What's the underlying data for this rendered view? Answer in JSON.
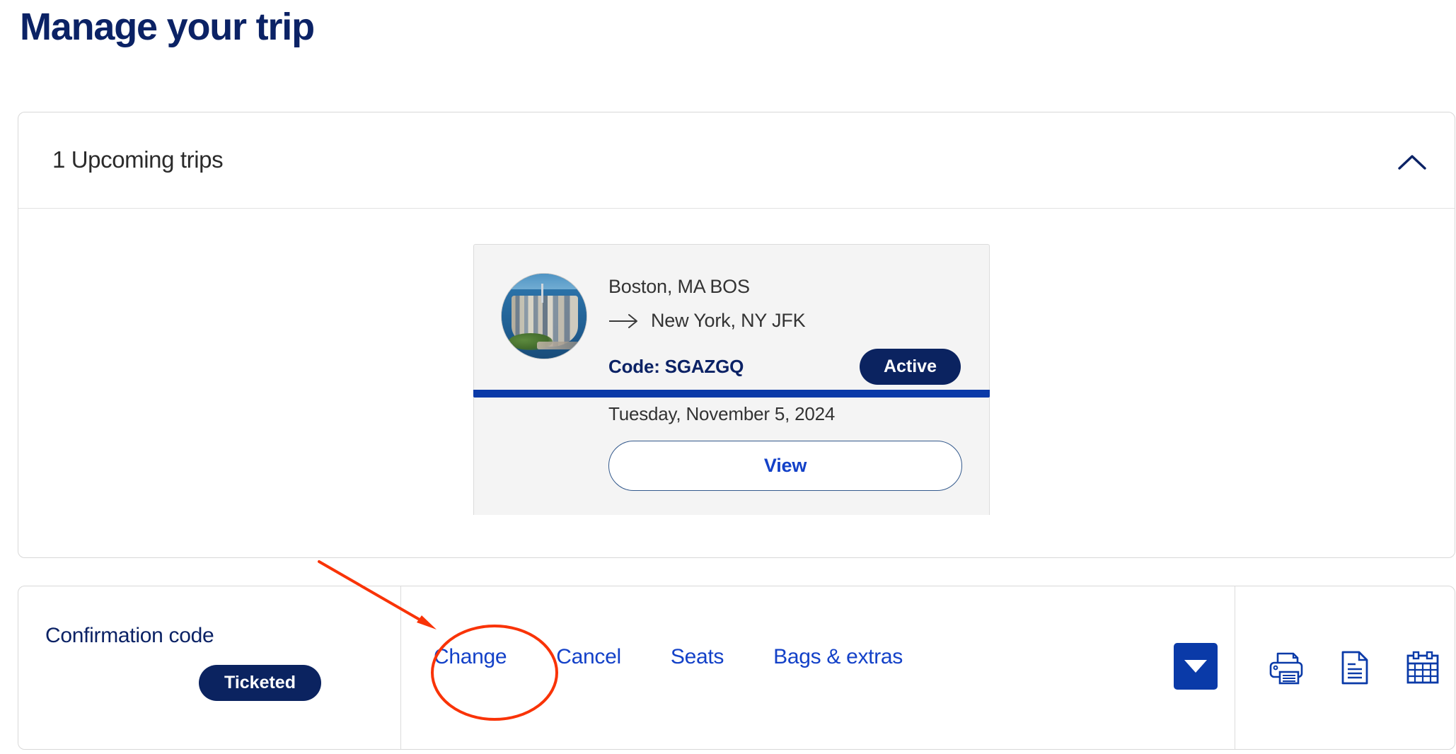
{
  "page": {
    "title": "Manage your trip"
  },
  "trips_section": {
    "header_title": "1 Upcoming trips",
    "collapse_icon": "chevron-up-icon"
  },
  "trip": {
    "thumbnail_alt": "new-york-city-aerial-photo",
    "origin": "Boston, MA BOS",
    "arrow_icon": "arrow-right-icon",
    "destination": "New York, NY JFK",
    "code_label": "Code: SGAZGQ",
    "status": "Active",
    "date": "Tuesday, November 5, 2024",
    "view_label": "View"
  },
  "actions": {
    "confirmation_label": "Confirmation code",
    "ticketed_status": "Ticketed",
    "links": [
      {
        "label": "Change",
        "name": "change-link"
      },
      {
        "label": "Cancel",
        "name": "cancel-link"
      },
      {
        "label": "Seats",
        "name": "seats-link"
      },
      {
        "label": "Bags & extras",
        "name": "bags-extras-link"
      }
    ],
    "dropdown_icon": "caret-down-icon",
    "icons": [
      {
        "name": "printer-icon"
      },
      {
        "name": "document-icon"
      },
      {
        "name": "calendar-icon"
      }
    ]
  },
  "colors": {
    "navy": "#0b2265",
    "accent_blue": "#1341c8",
    "button_blue": "#0a3aa8",
    "pill_navy": "#0b2360",
    "annotation_red": "#f93307",
    "tile_background": "#f4f4f4"
  },
  "annotation": {
    "highlight_target": "Change",
    "shapes": [
      "arrow",
      "ellipse"
    ]
  }
}
